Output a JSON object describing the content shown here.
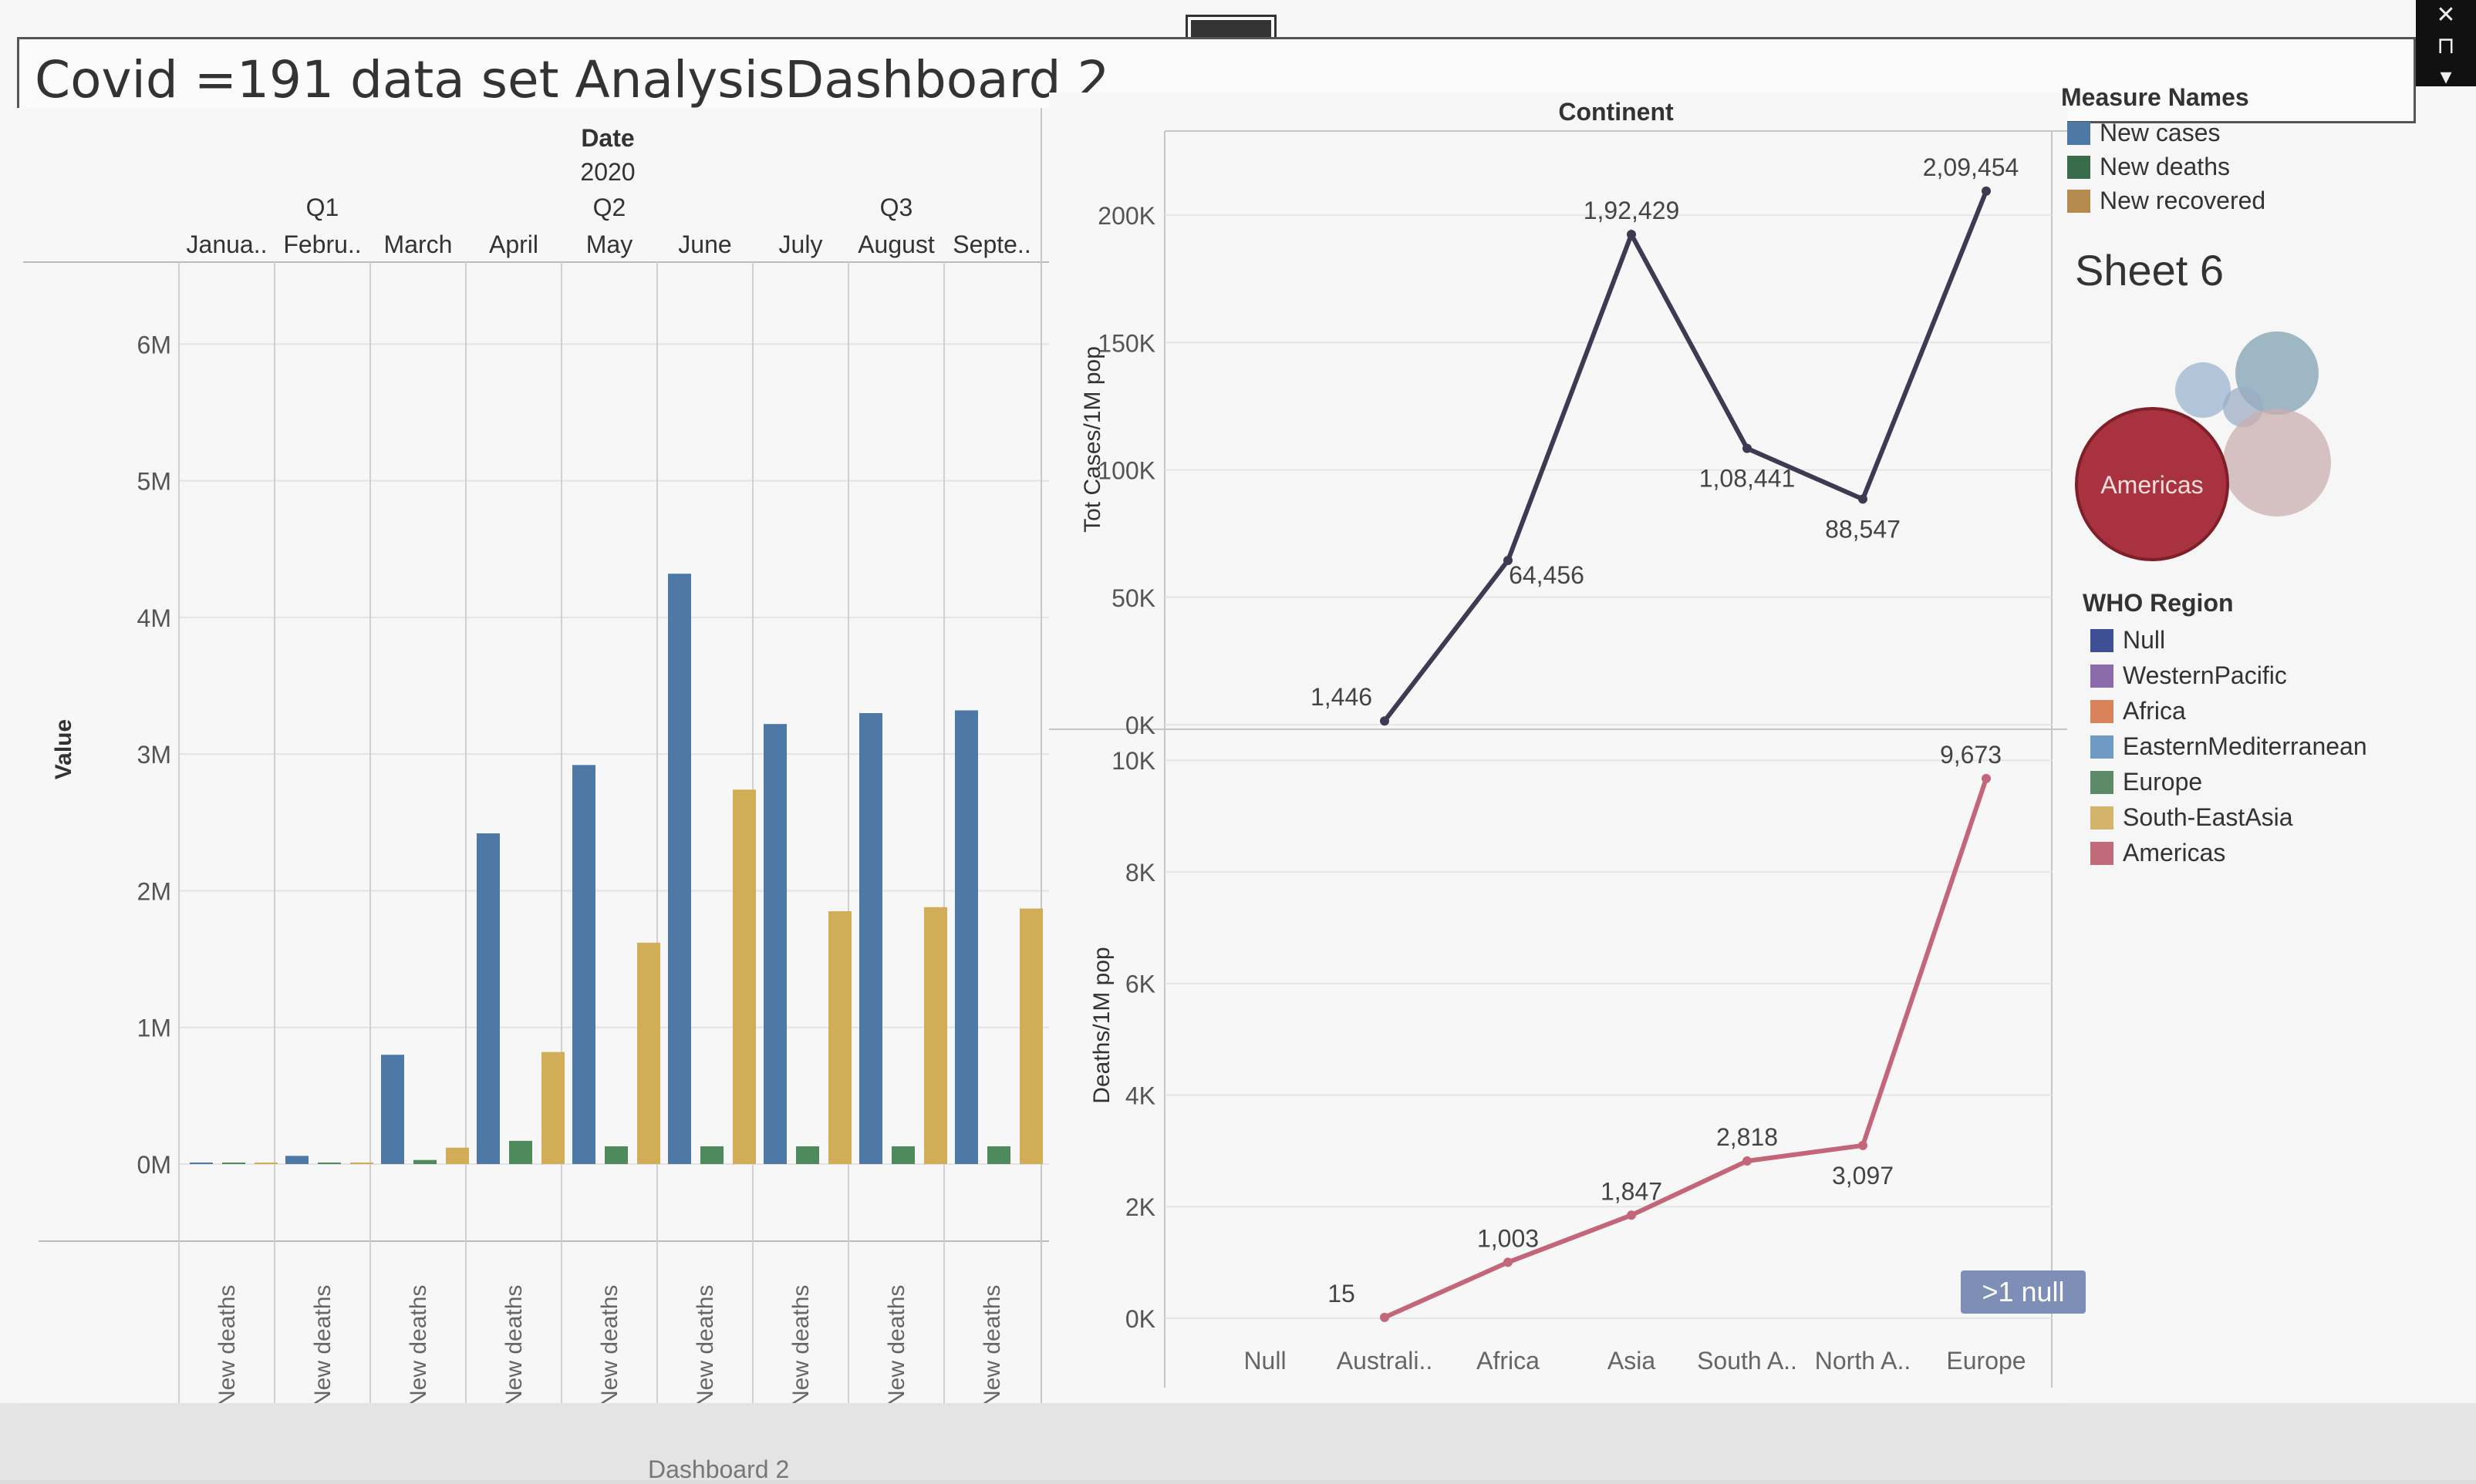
{
  "dashboard": {
    "title": "Covid =191 data set AnalysisDashboard 2",
    "tab_text": "Dashboard 2"
  },
  "bar_panel": {
    "header_top": "Date",
    "header_year": "2020",
    "quarters": [
      "Q1",
      "Q2",
      "Q3"
    ],
    "months": [
      "Janua..",
      "Febru..",
      "March",
      "April",
      "May",
      "June",
      "July",
      "August",
      "Septe.."
    ],
    "row_label": "New deaths"
  },
  "line_panel": {
    "header": "Continent",
    "null_badge": ">1 null"
  },
  "legend": {
    "measure_title": "Measure Names",
    "measures": [
      {
        "label": "New cases",
        "color": "#4e79a7"
      },
      {
        "label": "New deaths",
        "color": "#3a6b4a"
      },
      {
        "label": "New recovered",
        "color": "#b48a4e"
      }
    ],
    "sheet_title": "Sheet 6",
    "bubble_label": "Americas",
    "who_title": "WHO Region",
    "regions": [
      {
        "label": "Null",
        "color": "#3f4f96"
      },
      {
        "label": "WesternPacific",
        "color": "#8a6aa8"
      },
      {
        "label": "Africa",
        "color": "#d9835a"
      },
      {
        "label": "EasternMediterranean",
        "color": "#6f9ac4"
      },
      {
        "label": "Europe",
        "color": "#5d8a68"
      },
      {
        "label": "South-EastAsia",
        "color": "#d3b46a"
      },
      {
        "label": "Americas",
        "color": "#c06a7a"
      }
    ]
  },
  "chart_data": [
    {
      "type": "bar",
      "title": "",
      "xlabel": "",
      "ylabel": "Value",
      "ylim": [
        0,
        6600000
      ],
      "yticks": [
        "0M",
        "1M",
        "2M",
        "3M",
        "4M",
        "5M",
        "6M"
      ],
      "categories": [
        "Janua..",
        "Febru..",
        "March",
        "April",
        "May",
        "June",
        "July",
        "August",
        "Septe.."
      ],
      "series": [
        {
          "name": "New cases",
          "color": "#4e79a7",
          "values": [
            0,
            60000,
            800000,
            2420000,
            2920000,
            4320000,
            3220000,
            3300000,
            3320000
          ]
        },
        {
          "name": "New deaths",
          "color": "#4f8a5c",
          "values": [
            0,
            0,
            30000,
            170000,
            130000,
            130000,
            130000,
            130000,
            130000
          ]
        },
        {
          "name": "New recovered",
          "color": "#d2ad58",
          "values": [
            0,
            0,
            120000,
            820000,
            1620000,
            2740000,
            1850000,
            1880000,
            1870000
          ]
        }
      ]
    },
    {
      "type": "line",
      "title": "",
      "xlabel": "",
      "ylabel": "Tot Cases/1M pop",
      "ylim": [
        0,
        230000
      ],
      "yticks": [
        "0K",
        "50K",
        "100K",
        "150K",
        "200K"
      ],
      "x": [
        "Null",
        "Australi..",
        "Africa",
        "Asia",
        "South A..",
        "North A..",
        "Europe"
      ],
      "series": [
        {
          "name": "",
          "color": "#3d3a52",
          "values": [
            1446,
            64456,
            192429,
            108441,
            88547,
            209454
          ],
          "labels": [
            "1,446",
            "64,456",
            "1,92,429",
            "1,08,441",
            "88,547",
            "2,09,454"
          ]
        }
      ]
    },
    {
      "type": "line",
      "title": "",
      "xlabel": "",
      "ylabel": "Deaths/1M pop",
      "ylim": [
        0,
        10500
      ],
      "yticks": [
        "0K",
        "2K",
        "4K",
        "6K",
        "8K",
        "10K"
      ],
      "x": [
        "Null",
        "Australi..",
        "Africa",
        "Asia",
        "South A..",
        "North A..",
        "Europe"
      ],
      "series": [
        {
          "name": "",
          "color": "#c46679",
          "values": [
            15,
            1003,
            1847,
            2818,
            3097,
            9673
          ],
          "labels": [
            "15",
            "1,003",
            "1,847",
            "2,818",
            "3,097",
            "9,673"
          ]
        }
      ]
    }
  ]
}
